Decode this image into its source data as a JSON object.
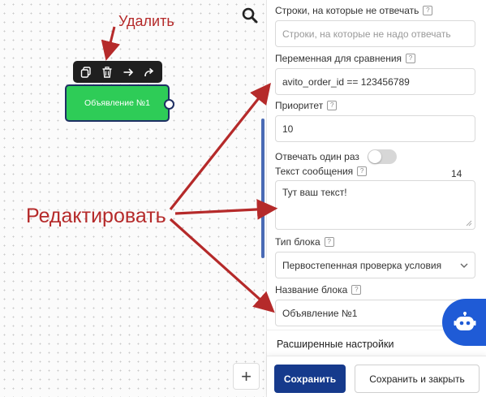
{
  "annotations": {
    "delete": "Удалить",
    "edit": "Редактировать"
  },
  "canvas": {
    "node_label": "Объявление №1",
    "toolbar_icons": [
      "copy-icon",
      "trash-icon",
      "arrow-right-icon",
      "share-icon"
    ],
    "add_button": "+"
  },
  "panel": {
    "ignore_lines": {
      "label": "Строки, на которые не отвечать",
      "placeholder": "Строки, на которые не надо отвечать"
    },
    "compare_var": {
      "label": "Переменная для сравнения",
      "value": "avito_order_id == 123456789"
    },
    "priority": {
      "label": "Приоритет",
      "value": "10"
    },
    "answer_once": {
      "label": "Отвечать один раз",
      "enabled": false
    },
    "message": {
      "label": "Текст сообщения",
      "value": "Тут ваш текст!",
      "counter": "14"
    },
    "block_type": {
      "label": "Тип блока",
      "value": "Первостепенная проверка условия"
    },
    "block_name": {
      "label": "Название блока",
      "value": "Объявление №1"
    },
    "advanced": "Расширенные настройки",
    "save": "Сохранить",
    "save_close": "Сохранить и закрыть"
  },
  "colors": {
    "node": "#2ecc57",
    "primary": "#163a8c",
    "annotation": "#b52a2a",
    "bot": "#1f5bd6"
  }
}
